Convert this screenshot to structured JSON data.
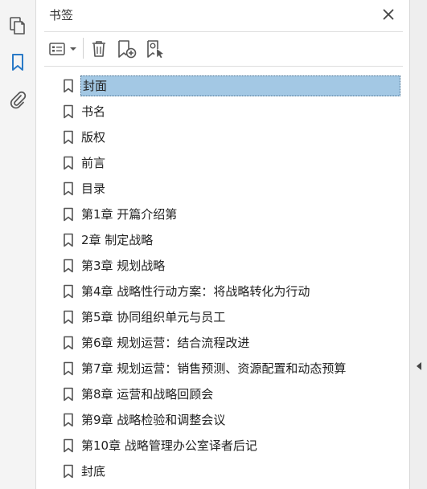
{
  "panel": {
    "title": "书签"
  },
  "rail": {
    "items": [
      {
        "icon": "pages-icon"
      },
      {
        "icon": "bookmark-icon"
      },
      {
        "icon": "attachment-icon"
      }
    ]
  },
  "toolbar": {
    "buttons": [
      {
        "icon": "options-menu-icon"
      },
      {
        "icon": "delete-icon"
      },
      {
        "icon": "new-bookmark-icon"
      },
      {
        "icon": "bookmark-from-selection-icon"
      }
    ]
  },
  "bookmarks": [
    {
      "label": "封面",
      "selected": true
    },
    {
      "label": "书名"
    },
    {
      "label": "版权"
    },
    {
      "label": "前言"
    },
    {
      "label": "目录"
    },
    {
      "label": "第1章 开篇介绍第"
    },
    {
      "label": "2章 制定战略"
    },
    {
      "label": "第3章 规划战略"
    },
    {
      "label": "第4章 战略性行动方案：将战略转化为行动"
    },
    {
      "label": "第5章 协同组织单元与员工"
    },
    {
      "label": "第6章 规划运营：结合流程改进"
    },
    {
      "label": "第7章 规划运营：销售预测、资源配置和动态预算"
    },
    {
      "label": "第8章 运营和战略回顾会"
    },
    {
      "label": "第9章 战略检验和调整会议"
    },
    {
      "label": "第10章 战略管理办公室译者后记"
    },
    {
      "label": "封底"
    }
  ],
  "colors": {
    "accent": "#2a7ac7",
    "selection": "#a3c8e4"
  }
}
